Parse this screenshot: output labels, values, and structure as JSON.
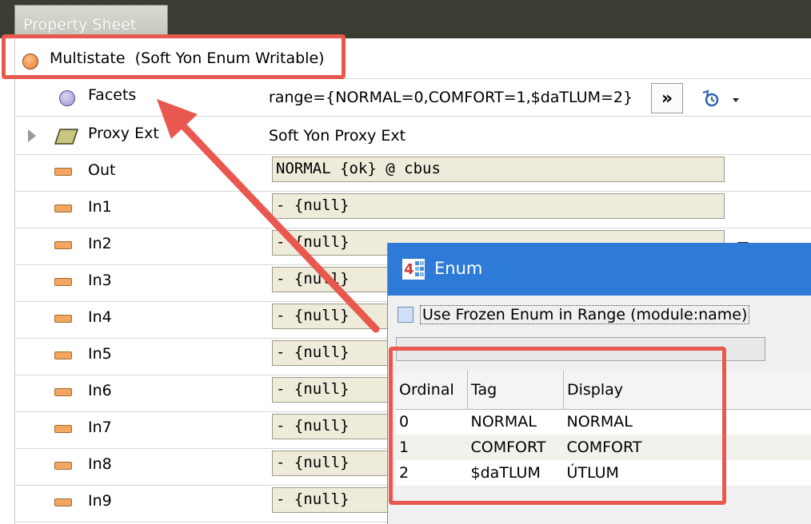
{
  "tab": {
    "label": "Property Sheet"
  },
  "header": {
    "title": "Multistate  (Soft Yon Enum Writable)"
  },
  "properties": {
    "facets": {
      "label": "Facets",
      "value": "range={NORMAL=0,COMFORT=1,$daTLUM=2}",
      "more_button": "»"
    },
    "proxy_ext": {
      "label": "Proxy Ext",
      "value": "Soft Yon Proxy Ext"
    },
    "slots": [
      {
        "label": "Out",
        "value": "NORMAL {ok} @ cbus"
      },
      {
        "label": "In1",
        "value": "- {null}"
      },
      {
        "label": "In2",
        "value": "- {null}"
      },
      {
        "label": "In3",
        "value": "- {null}"
      },
      {
        "label": "In4",
        "value": "- {null}"
      },
      {
        "label": "In5",
        "value": "- {null}"
      },
      {
        "label": "In6",
        "value": "- {null}"
      },
      {
        "label": "In7",
        "value": "- {null}"
      },
      {
        "label": "In8",
        "value": "- {null}"
      },
      {
        "label": "In9",
        "value": "- {null}"
      }
    ]
  },
  "dialog": {
    "title": "Enum",
    "checkbox_label": "Use Frozen Enum in Range (module:name)",
    "table": {
      "headers": [
        "Ordinal",
        "Tag",
        "Display"
      ],
      "rows": [
        [
          "0",
          "NORMAL",
          "NORMAL"
        ],
        [
          "1",
          "COMFORT",
          "COMFORT"
        ],
        [
          "2",
          "$daTLUM",
          "ÚTLUM"
        ]
      ]
    }
  },
  "colors": {
    "highlight": "#e8584f",
    "dialog_title": "#2d7bd6",
    "field_bg": "#efebdb",
    "slot_icon": "#f3a562"
  }
}
